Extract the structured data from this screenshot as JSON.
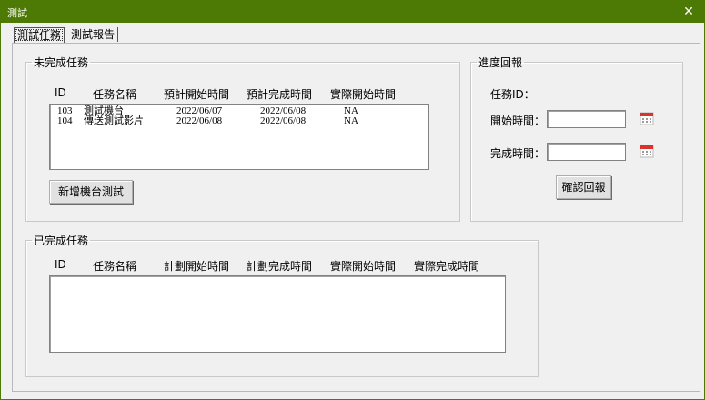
{
  "window": {
    "title": "測試",
    "close_glyph": "✕"
  },
  "tabs": [
    {
      "label": "測試任務",
      "active": true
    },
    {
      "label": "測試報告",
      "active": false
    }
  ],
  "pending": {
    "legend": "未完成任務",
    "columns": [
      "ID",
      "任務名稱",
      "預計開始時間",
      "預計完成時間",
      "實際開始時間"
    ],
    "rows": [
      {
        "id": "103",
        "name": "測試機台",
        "planned_start": "2022/06/07",
        "planned_end": "2022/06/08",
        "actual_start": "NA"
      },
      {
        "id": "104",
        "name": "傳送測試影片",
        "planned_start": "2022/06/08",
        "planned_end": "2022/06/08",
        "actual_start": "NA"
      }
    ],
    "add_button": "新增機台測試"
  },
  "progress": {
    "legend": "進度回報",
    "task_id_label": "任務ID：",
    "start_label": "開始時間：",
    "end_label": "完成時間：",
    "start_value": "",
    "end_value": "",
    "confirm_button": "確認回報",
    "calendar_icon": "calendar-icon"
  },
  "completed": {
    "legend": "已完成任務",
    "columns": [
      "ID",
      "任務名稱",
      "計劃開始時間",
      "計劃完成時間",
      "實際開始時間",
      "實際完成時間"
    ],
    "rows": []
  },
  "colors": {
    "titlebar": "#4d7a05",
    "dialog_bg": "#f0f0f0",
    "calendar_red": "#d9342b"
  }
}
